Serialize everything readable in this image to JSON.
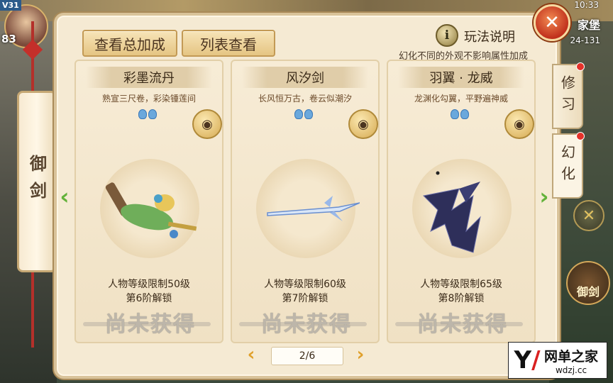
{
  "hud": {
    "version_badge": "V31",
    "player_level": "83",
    "time": "10:33",
    "map_name": "家堡",
    "map_coords": "24-131"
  },
  "left_tab": {
    "label": "御剑"
  },
  "toolbar": {
    "total_bonus_label": "查看总加成",
    "list_view_label": "列表查看"
  },
  "info": {
    "icon": "info-icon",
    "label": "玩法说明",
    "note": "幻化不同的外观不影响属性加成"
  },
  "close": {
    "icon": "close-icon"
  },
  "side_tabs": [
    {
      "label": "修习",
      "active": false
    },
    {
      "label": "幻化",
      "active": true
    }
  ],
  "cards": [
    {
      "title": "彩墨流丹",
      "desc": "熟宣三尺卷，彩染锺莲间",
      "level_req": "人物等级限制50级",
      "unlock": "第6阶解锁",
      "status": "尚未获得"
    },
    {
      "title": "风汐剑",
      "desc": "长风恒万古，卷云似潮汐",
      "level_req": "人物等级限制60级",
      "unlock": "第7阶解锁",
      "status": "尚未获得"
    },
    {
      "title": "羽翼 · 龙威",
      "desc": "龙渊化勾翼，平野遍神威",
      "level_req": "人物等级限制65级",
      "unlock": "第8阶解锁",
      "status": "尚未获得"
    }
  ],
  "pager": {
    "text": "2/6"
  },
  "game_buttons": {
    "sword_label": "御剑"
  },
  "watermark": {
    "brand": "网单之家",
    "domain": "wdzj.cc"
  },
  "colors": {
    "accent_green": "#63b23a",
    "pager_arrow": "#e0a02a",
    "close_red": "#c0301c"
  }
}
